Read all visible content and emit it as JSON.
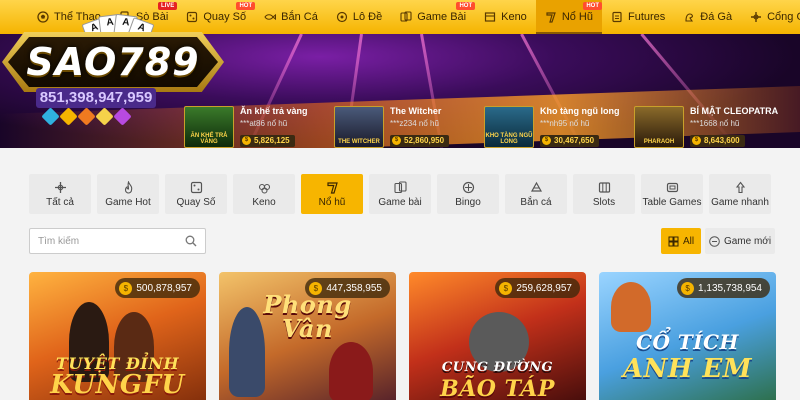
{
  "nav": {
    "items": [
      {
        "label": "Thể Thao",
        "icon": "soccer-ball-icon"
      },
      {
        "label": "Sò Bài",
        "icon": "cards-icon",
        "badge": "LIVE"
      },
      {
        "label": "Quay Số",
        "icon": "lottery-icon",
        "badge": "HOT"
      },
      {
        "label": "Bắn Cá",
        "icon": "fish-icon"
      },
      {
        "label": "Lô Đề",
        "icon": "ticket-icon"
      },
      {
        "label": "Game Bài",
        "icon": "card-game-icon",
        "badge": "HOT"
      },
      {
        "label": "Keno",
        "icon": "keno-icon"
      },
      {
        "label": "Nổ Hũ",
        "icon": "slot-icon",
        "badge": "HOT",
        "active": true
      },
      {
        "label": "Futures",
        "icon": "futures-icon"
      },
      {
        "label": "Đá Gà",
        "icon": "rooster-icon"
      },
      {
        "label": "Cổng Game",
        "icon": "gamepad-icon"
      }
    ]
  },
  "banner": {
    "logo_text": "SAO789",
    "jackpot_total": "851,398,947,959",
    "cards": [
      "A",
      "A",
      "A",
      "A"
    ],
    "promos": [
      {
        "thumb": "ĂN KHẾ TRẢ VÀNG",
        "title": "Ăn khế trả vàng",
        "user": "***at86 nổ hũ",
        "amount": "5,826,125"
      },
      {
        "thumb": "THE WITCHER",
        "title": "The Witcher",
        "user": "***z234 nổ hũ",
        "amount": "52,860,950"
      },
      {
        "thumb": "KHO TÀNG NGŨ LONG",
        "title": "Kho tàng ngũ long",
        "user": "***nh95 nổ hũ",
        "amount": "30,467,650"
      },
      {
        "thumb": "PHARAOH",
        "title": "BÍ MẬT CLEOPATRA",
        "user": "***1668 nổ hũ",
        "amount": "8,643,600"
      }
    ]
  },
  "filters": [
    {
      "label": "Tất cả",
      "icon": "grid-icon"
    },
    {
      "label": "Game Hot",
      "icon": "flame-icon"
    },
    {
      "label": "Quay Số",
      "icon": "lottery-icon"
    },
    {
      "label": "Keno",
      "icon": "keno-icon"
    },
    {
      "label": "Nổ hũ",
      "icon": "slot-icon",
      "active": true
    },
    {
      "label": "Game bài",
      "icon": "card-game-icon"
    },
    {
      "label": "Bingo",
      "icon": "bingo-icon"
    },
    {
      "label": "Bắn cá",
      "icon": "fish-icon"
    },
    {
      "label": "Slots",
      "icon": "slots-icon"
    },
    {
      "label": "Table Games",
      "icon": "table-icon"
    },
    {
      "label": "Game nhanh",
      "icon": "lightning-icon"
    }
  ],
  "search": {
    "placeholder": "Tìm kiếm",
    "value": ""
  },
  "sort": {
    "all_label": "All",
    "new_label": "Game mới"
  },
  "games": [
    {
      "title_line1": "TUYỆT ĐỈNH",
      "title_line2": "KUNGFU",
      "jackpot": "500,878,957"
    },
    {
      "title_line1": "Phong",
      "title_line2": "Vân",
      "jackpot": "447,358,955"
    },
    {
      "title_line1": "CUNG ĐƯỜNG",
      "title_line2": "BÃO TÁP",
      "jackpot": "259,628,957"
    },
    {
      "title_line1": "CỔ TÍCH",
      "title_line2": "ANH EM",
      "jackpot": "1,135,738,954"
    }
  ]
}
